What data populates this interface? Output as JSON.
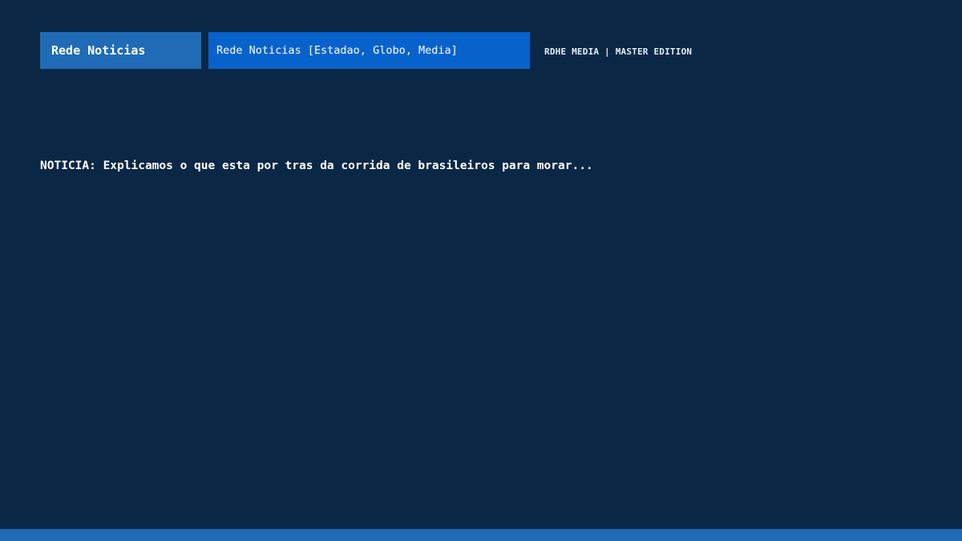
{
  "header": {
    "channel_button_label": "Rede Noticias",
    "source_field_value": "Rede Noticias [Estadao, Globo, Media]",
    "edition_label": "RDHE MEDIA | MASTER EDITION"
  },
  "main": {
    "headline": "NOTICIA: Explicamos o que esta por tras da corrida de brasileiros para morar..."
  },
  "colors": {
    "background": "#0a2745",
    "button": "#1f6bb5",
    "field": "#0862cc",
    "bottom_bar": "#1f6bb5"
  }
}
